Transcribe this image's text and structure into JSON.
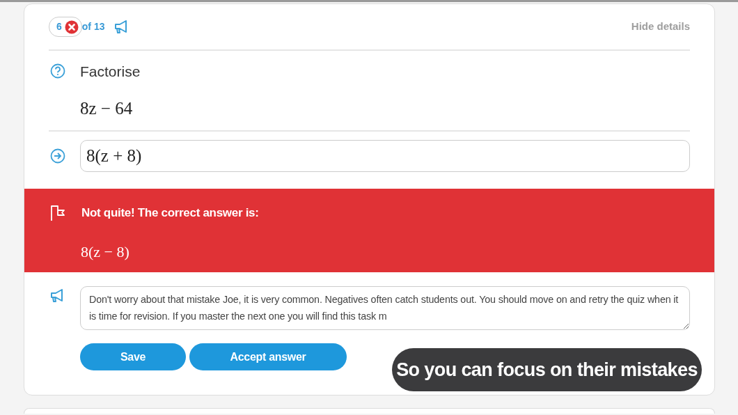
{
  "progress": {
    "current": "6",
    "correct": false,
    "total": "of 13"
  },
  "hide_details": "Hide details",
  "question": {
    "label": "Factorise",
    "expression": "8z − 64"
  },
  "answer": {
    "value": "8(z + 8)"
  },
  "feedback": {
    "kind": "incorrect",
    "message": "Not quite! The correct answer is:",
    "correct_answer": "8(z − 8)"
  },
  "comment": {
    "value": "Don't worry about that mistake Joe, it is very common. Negatives often catch students out. You should move on and retry the quiz when it is time for revision. If you master the next one you will find this task m"
  },
  "buttons": [
    {
      "label": "Save"
    },
    {
      "label": "Accept answer"
    }
  ],
  "caption": "So you can focus on their mistakes"
}
